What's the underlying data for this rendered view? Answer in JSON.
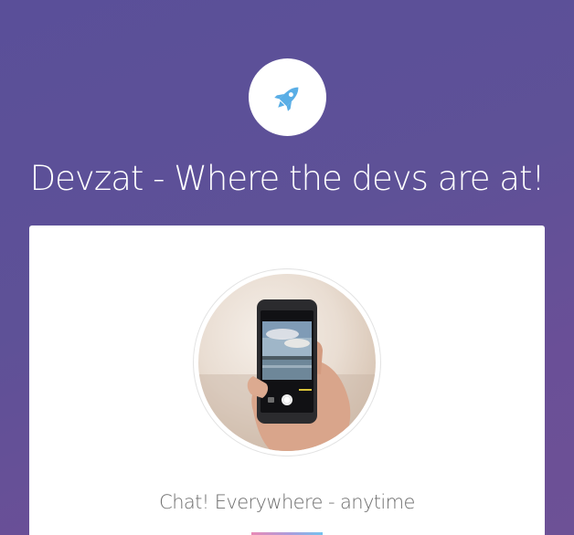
{
  "header": {
    "logo_icon": "rocket-icon",
    "logo_color": "#5aaee6",
    "title": "Devzat - Where the devs are at!"
  },
  "card": {
    "image_description_icon": "phone-photo",
    "tagline": "Chat! Everywhere - anytime"
  },
  "colors": {
    "background": "#5e5197",
    "card": "#ffffff",
    "title_text": "#ffffff",
    "tagline_text": "#6e6e6e"
  }
}
